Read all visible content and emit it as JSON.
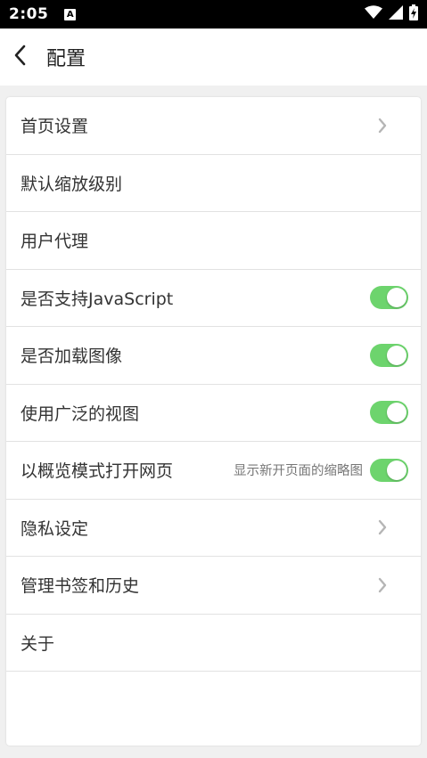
{
  "status_bar": {
    "time": "2:05",
    "a_icon": "A",
    "icons": [
      "notification-a-icon",
      "wifi-icon",
      "cell-signal-icon",
      "battery-charging-icon"
    ]
  },
  "app_bar": {
    "title": "配置",
    "back_icon": "chevron-left-icon"
  },
  "colors": {
    "switch_on": "#6dd46d",
    "chevron": "#b5b5b5",
    "text": "#333333",
    "hint": "#777777"
  },
  "settings": [
    {
      "label": "首页设置",
      "control": "chevron"
    },
    {
      "label": "默认缩放级别",
      "control": "none"
    },
    {
      "label": "用户代理",
      "control": "none"
    },
    {
      "label": "是否支持JavaScript",
      "control": "switch",
      "checked": true
    },
    {
      "label": "是否加载图像",
      "control": "switch",
      "checked": true
    },
    {
      "label": "使用广泛的视图",
      "control": "switch",
      "checked": true
    },
    {
      "label": "以概览模式打开网页",
      "hint": "显示新开页面的缩略图",
      "control": "switch",
      "checked": true
    },
    {
      "label": "隐私设定",
      "control": "chevron"
    },
    {
      "label": "管理书签和历史",
      "control": "chevron"
    },
    {
      "label": "关于",
      "control": "none"
    }
  ]
}
